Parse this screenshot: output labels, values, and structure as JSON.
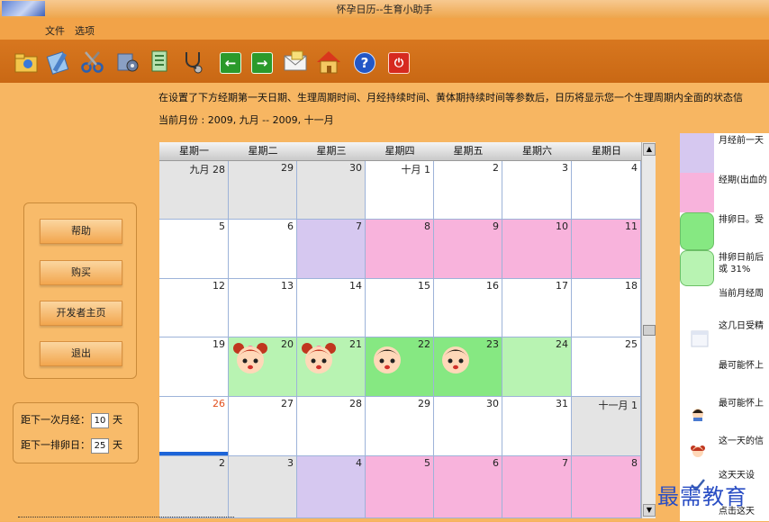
{
  "window": {
    "title": "怀孕日历--生育小助手"
  },
  "menu": [
    "文件",
    "选项"
  ],
  "toolbar": {
    "icons": [
      "open-folder-icon",
      "edit-icon",
      "scissors-icon",
      "settings-icon",
      "document-icon",
      "stethoscope-icon",
      "arrow-left-icon",
      "arrow-right-icon",
      "mail-icon",
      "home-icon",
      "help-icon",
      "power-icon"
    ],
    "arrow_left": "←",
    "arrow_right": "→",
    "help": "?",
    "power": "⏻"
  },
  "info": {
    "description": "在设置了下方经期第一天日期、生理周期时间、月经持续时间、黄体期持续时间等参数后，日历将显示您一个生理周期内全面的状态信",
    "current_month": "当前月份 : 2009, 九月 -- 2009, 十一月"
  },
  "side_buttons": [
    "帮助",
    "购买",
    "开发者主页",
    "退出"
  ],
  "countdown": {
    "next_period_label": "距下一次月经：",
    "next_period_value": "10",
    "next_ovulation_label": "距下一排卵日：",
    "next_ovulation_value": "25",
    "unit": "天"
  },
  "calendar": {
    "weekdays": [
      "星期一",
      "星期二",
      "星期三",
      "星期四",
      "星期五",
      "星期六",
      "星期日"
    ],
    "weeks": [
      [
        {
          "label": "九月  28",
          "style": "gray"
        },
        {
          "label": "29",
          "style": "gray"
        },
        {
          "label": "30",
          "style": "gray"
        },
        {
          "label": "十月  1",
          "style": "white"
        },
        {
          "label": "2",
          "style": "white"
        },
        {
          "label": "3",
          "style": "white"
        },
        {
          "label": "4",
          "style": "white"
        }
      ],
      [
        {
          "label": "5",
          "style": "white"
        },
        {
          "label": "6",
          "style": "white"
        },
        {
          "label": "7",
          "style": "lav"
        },
        {
          "label": "8",
          "style": "pink"
        },
        {
          "label": "9",
          "style": "pink"
        },
        {
          "label": "10",
          "style": "pink"
        },
        {
          "label": "11",
          "style": "pink"
        }
      ],
      [
        {
          "label": "12",
          "style": "white"
        },
        {
          "label": "13",
          "style": "white"
        },
        {
          "label": "14",
          "style": "white"
        },
        {
          "label": "15",
          "style": "white"
        },
        {
          "label": "16",
          "style": "white"
        },
        {
          "label": "17",
          "style": "white"
        },
        {
          "label": "18",
          "style": "white"
        }
      ],
      [
        {
          "label": "19",
          "style": "white"
        },
        {
          "label": "20",
          "style": "lgreen",
          "face": "girl"
        },
        {
          "label": "21",
          "style": "lgreen",
          "face": "girl"
        },
        {
          "label": "22",
          "style": "green",
          "face": "boy"
        },
        {
          "label": "23",
          "style": "green",
          "face": "boy"
        },
        {
          "label": "24",
          "style": "lgreen"
        },
        {
          "label": "25",
          "style": "white"
        }
      ],
      [
        {
          "label": "26",
          "style": "white",
          "red": true,
          "today": true
        },
        {
          "label": "27",
          "style": "white"
        },
        {
          "label": "28",
          "style": "white"
        },
        {
          "label": "29",
          "style": "white"
        },
        {
          "label": "30",
          "style": "white"
        },
        {
          "label": "31",
          "style": "white"
        },
        {
          "label": "十一月  1",
          "style": "gray"
        }
      ],
      [
        {
          "label": "2",
          "style": "gray"
        },
        {
          "label": "3",
          "style": "gray"
        },
        {
          "label": "4",
          "style": "lav"
        },
        {
          "label": "5",
          "style": "pink"
        },
        {
          "label": "6",
          "style": "pink"
        },
        {
          "label": "7",
          "style": "pink"
        },
        {
          "label": "8",
          "style": "pink"
        }
      ]
    ]
  },
  "legend": [
    {
      "swatch": "#d6c8f0",
      "text": "月经前一天"
    },
    {
      "swatch": "#f8b3dc",
      "text": "经期(出血的"
    },
    {
      "swatch": "#86e882",
      "text": "排卵日。受"
    },
    {
      "swatch": "#b8f3b2",
      "text": "排卵日前后\n或 31%"
    },
    {
      "swatch": "#ffffff",
      "text": "当前月经周"
    },
    {
      "icon": "calendar-icon",
      "text": "这几日受精"
    },
    {
      "icon": "",
      "text": "最可能怀上"
    },
    {
      "icon": "boy-icon",
      "text": "最可能怀上"
    },
    {
      "icon": "girl-icon",
      "text": "这一天的信"
    },
    {
      "icon": "checkmark-icon",
      "text": "这天天设"
    },
    {
      "icon": "",
      "text": "点击这天"
    }
  ],
  "watermark": "最需教育",
  "colors": {
    "background": "#f7b662",
    "toolbar": "#d17019",
    "lavender": "#d6c8f0",
    "pink": "#f8b3dc",
    "green": "#86e882",
    "light_green": "#b8f3b2",
    "today": "#1c64d8"
  }
}
